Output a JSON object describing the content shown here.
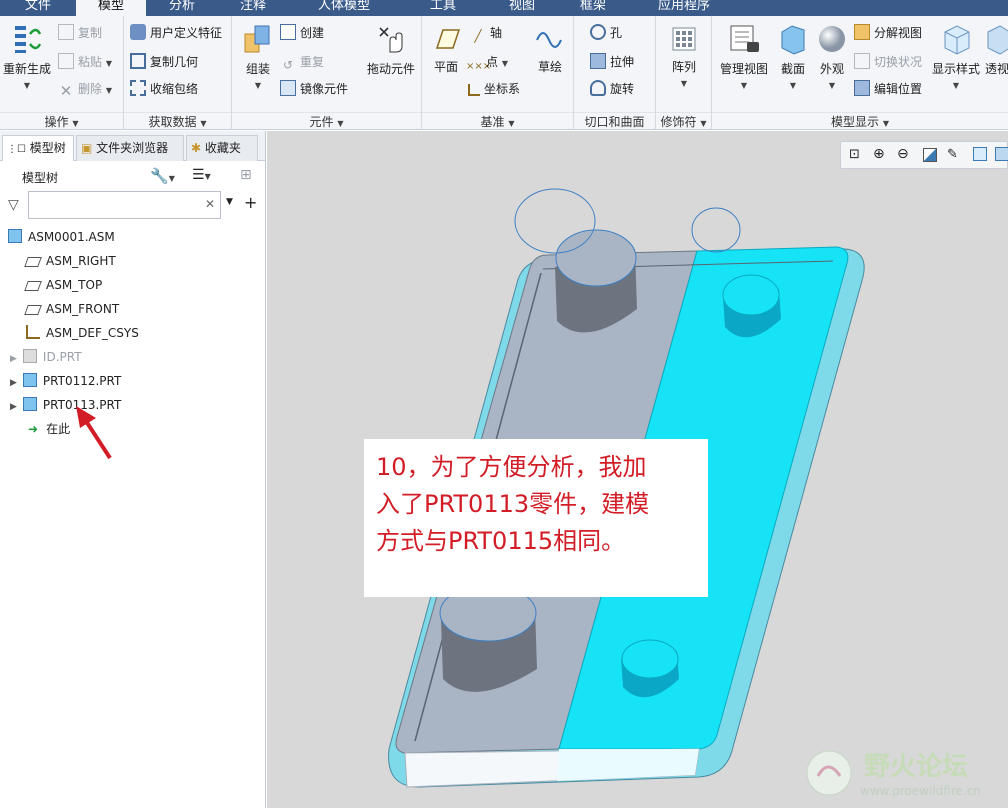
{
  "menu_tabs": [
    "文件",
    "模型",
    "分析",
    "注释",
    "人体模型",
    "工具",
    "视图",
    "框架",
    "应用程序"
  ],
  "ribbon": {
    "operations": {
      "regenerate": "重新生成",
      "copy": "复制",
      "paste": "粘贴",
      "delete": "删除",
      "group": "操作"
    },
    "get_data": {
      "udf": "用户定义特征",
      "copy_geom": "复制几何",
      "shrinkwrap": "收缩包络",
      "group": "获取数据"
    },
    "components": {
      "assemble": "组装",
      "create": "创建",
      "repeat": "重复",
      "mirror": "镜像元件",
      "drag": "拖动元件",
      "group": "元件"
    },
    "datum": {
      "plane": "平面",
      "axis": "轴",
      "point": "点",
      "csys": "坐标系",
      "sketch": "草绘",
      "group": "基准"
    },
    "cut_surface": {
      "hole": "孔",
      "extrude": "拉伸",
      "revolve": "旋转",
      "group": "切口和曲面"
    },
    "modifiers": {
      "pattern": "阵列",
      "group": "修饰符"
    },
    "model_display": {
      "manage_views": "管理视图",
      "section": "截面",
      "appearance": "外观",
      "explode": "分解视图",
      "toggle_state": "切换状况",
      "edit_position": "编辑位置",
      "display_style": "显示样式",
      "perspective": "透视",
      "group": "模型显示"
    }
  },
  "panel": {
    "tabs": [
      "模型树",
      "文件夹浏览器",
      "收藏夹"
    ],
    "tree_title": "模型树",
    "filter_placeholder": "",
    "tree": [
      {
        "label": "ASM0001.ASM",
        "icon": "assembly-icon"
      },
      {
        "label": "ASM_RIGHT",
        "icon": "datum-plane-icon"
      },
      {
        "label": "ASM_TOP",
        "icon": "datum-plane-icon"
      },
      {
        "label": "ASM_FRONT",
        "icon": "datum-plane-icon"
      },
      {
        "label": "ASM_DEF_CSYS",
        "icon": "csys-icon"
      },
      {
        "label": "ID.PRT",
        "icon": "part-icon",
        "suppressed": true
      },
      {
        "label": "PRT0112.PRT",
        "icon": "part-icon"
      },
      {
        "label": "PRT0113.PRT",
        "icon": "part-icon"
      },
      {
        "label": "在此",
        "icon": "insert-here-icon"
      }
    ]
  },
  "callout": {
    "lines": [
      "10，为了方便分析，我加",
      "入了PRT0113零件，建模",
      "方式与PRT0115相同。"
    ]
  },
  "watermark": {
    "title": "野火论坛",
    "url": "www.proewildfire.cn"
  },
  "colors": {
    "cyan_part": "#17e3f7",
    "gray_part": "#a9b5c5",
    "annotation_red": "#d21d27",
    "menubar": "#3a5a89"
  }
}
